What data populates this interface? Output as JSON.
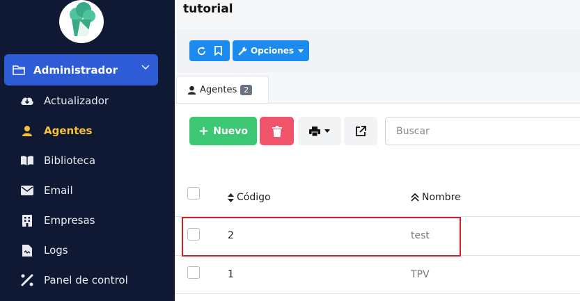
{
  "sidebar": {
    "section_label": "Administrador",
    "items": [
      {
        "label": "Actualizador",
        "icon": "cloud-download-icon",
        "active": false
      },
      {
        "label": "Agentes",
        "icon": "user-icon",
        "active": true
      },
      {
        "label": "Biblioteca",
        "icon": "book-icon",
        "active": false
      },
      {
        "label": "Email",
        "icon": "envelope-icon",
        "active": false
      },
      {
        "label": "Empresas",
        "icon": "building-icon",
        "active": false
      },
      {
        "label": "Logs",
        "icon": "file-icon",
        "active": false
      },
      {
        "label": "Panel de control",
        "icon": "tools-icon",
        "active": false
      }
    ]
  },
  "header": {
    "title": "tutorial",
    "options_label": "Opciones"
  },
  "tabs": [
    {
      "label": "Agentes",
      "count": "2"
    }
  ],
  "actions": {
    "new_label": "Nuevo",
    "search_placeholder": "Buscar"
  },
  "table": {
    "columns": [
      "Código",
      "Nombre"
    ],
    "rows": [
      {
        "code": "2",
        "name": "test"
      },
      {
        "code": "1",
        "name": "TPV"
      }
    ]
  },
  "colors": {
    "sidebar_bg": "#0f1933",
    "section_active": "#2e5bd6",
    "active_item": "#f5c23a",
    "primary": "#1b8bf0",
    "success": "#3cc772",
    "danger": "#f0546b",
    "highlight": "#d0212b"
  }
}
